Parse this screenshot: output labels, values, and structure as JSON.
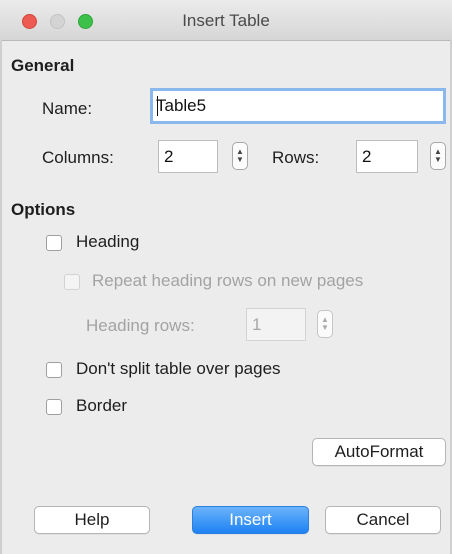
{
  "window": {
    "title": "Insert Table"
  },
  "general": {
    "heading": "General",
    "name_label": "Name:",
    "name_value": "Table5",
    "columns_label": "Columns:",
    "columns_value": "2",
    "rows_label": "Rows:",
    "rows_value": "2"
  },
  "options": {
    "heading": "Options",
    "heading_checkbox": "Heading",
    "repeat_checkbox": "Repeat heading rows on new pages",
    "heading_rows_label": "Heading rows:",
    "heading_rows_value": "1",
    "dont_split_checkbox": "Don't split table over pages",
    "border_checkbox": "Border"
  },
  "buttons": {
    "autoformat": "AutoFormat",
    "help": "Help",
    "insert": "Insert",
    "cancel": "Cancel"
  },
  "colors": {
    "primary": "#1d82f3",
    "focus_ring": "#8ab8ed"
  }
}
